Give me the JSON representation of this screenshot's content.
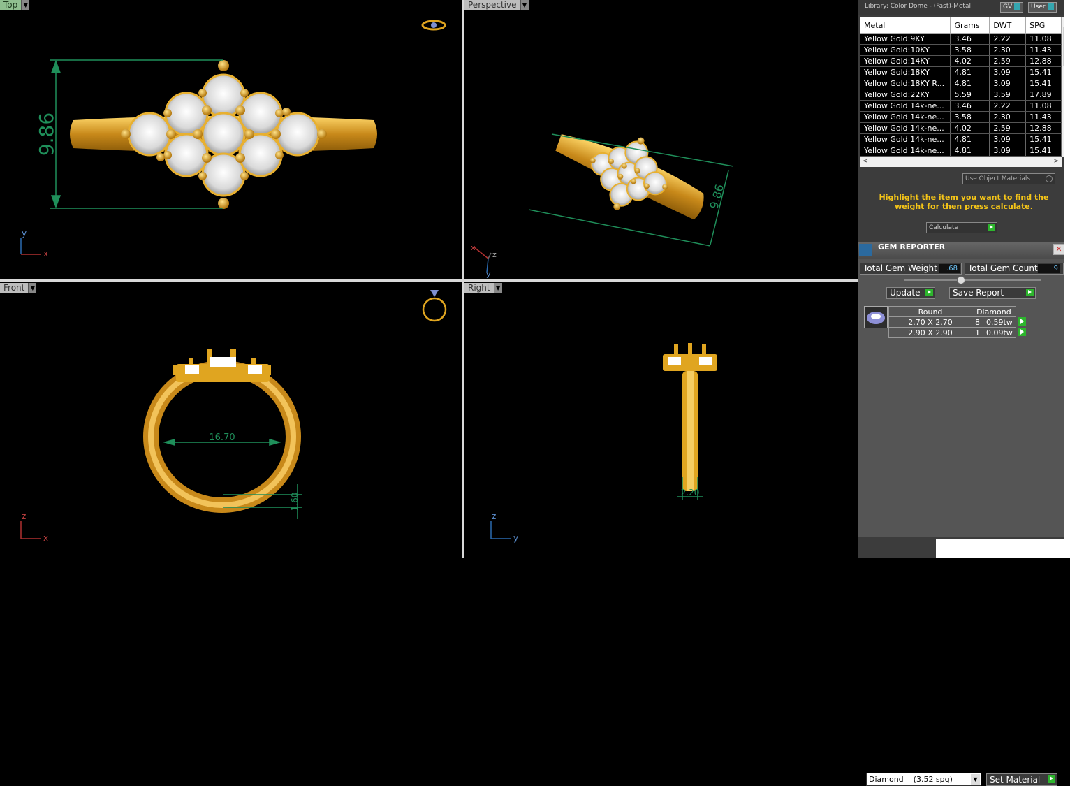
{
  "viewports": {
    "top": {
      "label": "Top",
      "dimension": "9.86",
      "axis1": "y",
      "axis2": "x"
    },
    "perspective": {
      "label": "Perspective",
      "dimension": "9.86",
      "axis1": "x",
      "axis2": "z",
      "axis3": "y"
    },
    "front": {
      "label": "Front",
      "inner_diameter": "16.70",
      "band_thickness": "1.60",
      "axis1": "z",
      "axis2": "x"
    },
    "right": {
      "label": "Right",
      "shank_width": "2.20",
      "axis1": "z",
      "axis2": "y"
    }
  },
  "library": {
    "title": "Library: Color Dome - (Fast)-Metal",
    "btn_gv": "GV",
    "btn_user": "User",
    "columns": [
      "Metal",
      "Grams",
      "DWT",
      "SPG"
    ],
    "rows": [
      [
        "Yellow Gold:9KY",
        "3.46",
        "2.22",
        "11.08"
      ],
      [
        "Yellow Gold:10KY",
        "3.58",
        "2.30",
        "11.43"
      ],
      [
        "Yellow Gold:14KY",
        "4.02",
        "2.59",
        "12.88"
      ],
      [
        "Yellow Gold:18KY",
        "4.81",
        "3.09",
        "15.41"
      ],
      [
        "Yellow Gold:18KY R...",
        "4.81",
        "3.09",
        "15.41"
      ],
      [
        "Yellow Gold:22KY",
        "5.59",
        "3.59",
        "17.89"
      ],
      [
        "Yellow Gold 14k-ne...",
        "3.46",
        "2.22",
        "11.08"
      ],
      [
        "Yellow Gold 14k-ne...",
        "3.58",
        "2.30",
        "11.43"
      ],
      [
        "Yellow Gold 14k-ne...",
        "4.02",
        "2.59",
        "12.88"
      ],
      [
        "Yellow Gold 14k-ne...",
        "4.81",
        "3.09",
        "15.41"
      ],
      [
        "Yellow Gold 14k-ne...",
        "4.81",
        "3.09",
        "15.41"
      ]
    ],
    "use_object_materials": "Use Object Materials",
    "instruction": "Highlight the item you want to find the weight for then press calculate.",
    "calculate_label": "Calculate"
  },
  "gem_reporter": {
    "title": "GEM REPORTER",
    "total_weight_label": "Total Gem Weight",
    "total_weight_value": ".68",
    "total_count_label": "Total Gem Count",
    "total_count_value": "9",
    "update_label": "Update",
    "save_report_label": "Save Report",
    "table_headers": [
      "Round",
      "Diamond"
    ],
    "gems": [
      {
        "size": "2.70 X 2.70",
        "count": "8",
        "weight": "0.59tw"
      },
      {
        "size": "2.90 X 2.90",
        "count": "1",
        "weight": "0.09tw"
      }
    ],
    "material_select": "Diamond    (3.52 spg)",
    "set_material_label": "Set Material"
  },
  "colors": {
    "gold": "#e0a520",
    "dim_green": "#1f8f5a",
    "panel_bg": "#555555",
    "accent_yellow": "#f5c518"
  }
}
